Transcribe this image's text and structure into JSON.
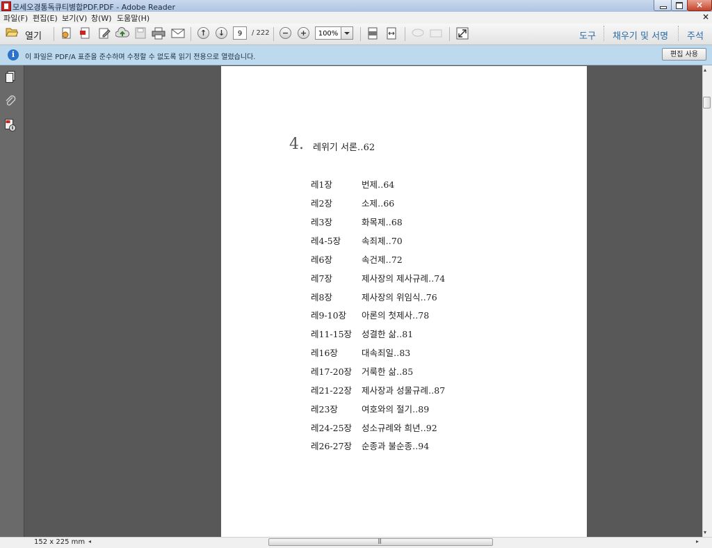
{
  "window": {
    "title": "모세오경통독큐티병합PDF.PDF - Adobe Reader"
  },
  "menu": {
    "items": [
      "파일(F)",
      "편집(E)",
      "보기(V)",
      "창(W)",
      "도움말(H)"
    ],
    "close_glyph": "×"
  },
  "toolbar": {
    "open_label": "열기",
    "page_current": "9",
    "page_total": "/ 222",
    "zoom": "100%",
    "tools_label": "도구",
    "fill_sign_label": "채우기 및 서명",
    "comment_label": "주석",
    "zoom_out_glyph": "−",
    "zoom_in_glyph": "+",
    "prev_page_glyph": "↑",
    "next_page_glyph": "↓"
  },
  "infobar": {
    "icon_glyph": "i",
    "message": "이 파일은 PDF/A 표준을 준수하며 수정할 수 없도록 읽기 전용으로 열렸습니다.",
    "button_label": "편집 사용"
  },
  "document": {
    "chapter_number": "4.",
    "chapter_title": "레위기 서론‥62",
    "toc": [
      {
        "ch": "레1장",
        "title": "번제‥64"
      },
      {
        "ch": "레2장",
        "title": "소제‥66"
      },
      {
        "ch": "레3장",
        "title": "화목제‥68"
      },
      {
        "ch": "레4-5장",
        "title": "속죄제‥70"
      },
      {
        "ch": "레6장",
        "title": "속건제‥72"
      },
      {
        "ch": "레7장",
        "title": "제사장의 제사규례‥74"
      },
      {
        "ch": "레8장",
        "title": "제사장의 위임식‥76"
      },
      {
        "ch": "레9-10장",
        "title": "아론의 첫제사‥78"
      },
      {
        "ch": "레11-15장",
        "title": "성결한 삶‥81"
      },
      {
        "ch": "레16장",
        "title": "대속죄일‥83"
      },
      {
        "ch": "레17-20장",
        "title": "거룩한 삶‥85"
      },
      {
        "ch": "레21-22장",
        "title": "제사장과 성물규례‥87"
      },
      {
        "ch": "레23장",
        "title": "여호와의 절기‥89"
      },
      {
        "ch": "레24-25장",
        "title": "성소규례와 희년‥92"
      },
      {
        "ch": "레26-27장",
        "title": "순종과 불순종‥94"
      }
    ]
  },
  "status": {
    "page_size": "152 x 225 mm",
    "scroll_left_glyph": "◂",
    "scroll_right_glyph": "▸",
    "scroll_up_glyph": "▴",
    "scroll_down_glyph": "▾",
    "grip_glyph": "|||"
  },
  "colors": {
    "accent_link": "#2a6aa5",
    "infobar_bg": "#bcd9ee",
    "doc_background": "#585858"
  }
}
